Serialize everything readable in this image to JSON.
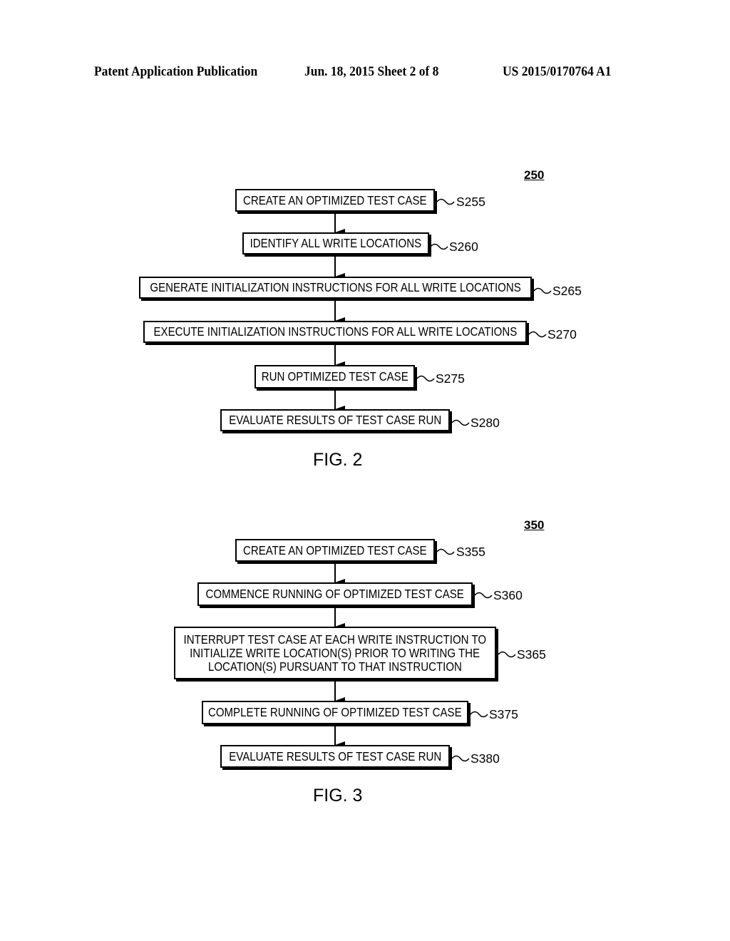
{
  "header": {
    "publication": "Patent Application Publication",
    "date_sheet": "Jun. 18, 2015  Sheet 2 of 8",
    "number": "US 2015/0170764 A1"
  },
  "fig2": {
    "ref": "250",
    "caption": "FIG. 2",
    "steps": [
      {
        "text": "CREATE AN OPTIMIZED TEST CASE",
        "label": "S255"
      },
      {
        "text": "IDENTIFY ALL WRITE LOCATIONS",
        "label": "S260"
      },
      {
        "text": "GENERATE INITIALIZATION INSTRUCTIONS FOR ALL WRITE LOCATIONS",
        "label": "S265"
      },
      {
        "text": "EXECUTE INITIALIZATION INSTRUCTIONS FOR ALL WRITE LOCATIONS",
        "label": "S270"
      },
      {
        "text": "RUN OPTIMIZED TEST CASE",
        "label": "S275"
      },
      {
        "text": "EVALUATE RESULTS OF TEST CASE RUN",
        "label": "S280"
      }
    ]
  },
  "fig3": {
    "ref": "350",
    "caption": "FIG. 3",
    "steps": [
      {
        "text": "CREATE AN OPTIMIZED TEST CASE",
        "label": "S355"
      },
      {
        "text": "COMMENCE RUNNING OF OPTIMIZED TEST CASE",
        "label": "S360"
      },
      {
        "lines": [
          "INTERRUPT TEST CASE AT EACH WRITE INSTRUCTION TO",
          "INITIALIZE WRITE LOCATION(S) PRIOR TO WRITING THE",
          "LOCATION(S) PURSUANT TO THAT INSTRUCTION"
        ],
        "label": "S365"
      },
      {
        "text": "COMPLETE RUNNING OF OPTIMIZED TEST CASE",
        "label": "S375"
      },
      {
        "text": "EVALUATE RESULTS OF TEST CASE RUN",
        "label": "S380"
      }
    ]
  }
}
